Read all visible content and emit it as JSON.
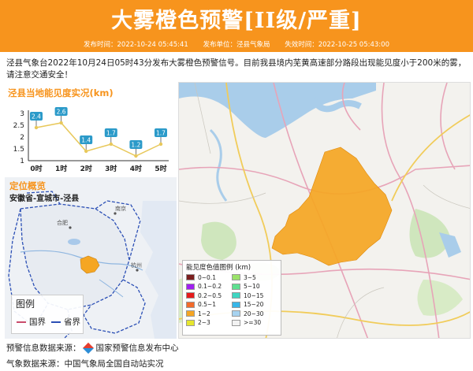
{
  "banner": {
    "title": "大雾橙色预警[II级/严重]",
    "publish_time": "发布时间：2022-10-24 05:45:41",
    "publisher": "发布单位：泾县气象局",
    "expire_time": "失效时间：2022-10-25 05:43:00"
  },
  "description": "泾县气象台2022年10月24日05时43分发布大雾橙色预警信号。目前我县境内芜黄高速部分路段出现能见度小于200米的雾，请注意交通安全！",
  "visibility_panel": {
    "title": "泾县当地能见度实况(km)"
  },
  "chart_data": {
    "type": "line",
    "title": "泾县当地能见度实况(km)",
    "categories": [
      "0时",
      "1时",
      "2时",
      "3时",
      "4时",
      "5时"
    ],
    "values": [
      2.4,
      2.6,
      1.4,
      1.7,
      1.2,
      1.7
    ],
    "ylim": [
      1,
      3
    ],
    "yticks": [
      "3",
      "2.5",
      "2",
      "1.5",
      "1"
    ],
    "grid": false
  },
  "location_panel": {
    "title": "定位概览",
    "region": "安徽省-宣城市-泾县",
    "city_labels": [
      "合肥",
      "南京",
      "杭州"
    ],
    "legend": {
      "title": "图例",
      "items": [
        {
          "label": "国界",
          "color": "#c94c6c"
        },
        {
          "label": "省界",
          "color": "#2b4fb5"
        }
      ]
    }
  },
  "visibility_legend": {
    "title": "能见度色值图例 (km)",
    "items": [
      {
        "label": "0~0.1",
        "color": "#7b1f1f"
      },
      {
        "label": "3~5",
        "color": "#9be36a"
      },
      {
        "label": "0.1~0.2",
        "color": "#a020f0"
      },
      {
        "label": "5~10",
        "color": "#5ee090"
      },
      {
        "label": "0.2~0.5",
        "color": "#e51b1b"
      },
      {
        "label": "10~15",
        "color": "#3fd6c2"
      },
      {
        "label": "0.5~1",
        "color": "#f26b2a"
      },
      {
        "label": "15~20",
        "color": "#38b6e8"
      },
      {
        "label": "1~2",
        "color": "#f5a623"
      },
      {
        "label": "20~30",
        "color": "#a7d3f0"
      },
      {
        "label": "2~3",
        "color": "#e6e62e"
      },
      {
        "label": ">=30",
        "color": "#f2f2f2"
      }
    ]
  },
  "footer": {
    "warning_source": "预警信息数据来源：",
    "warning_source_name": "国家预警信息发布中心",
    "weather_source": "气象数据来源：中国气象局全国自动站实况"
  },
  "colors": {
    "accent": "#f7941d",
    "fog_area": "#f5a623",
    "chart_line": "#e8c85a",
    "chart_label": "#2b9ac9"
  }
}
